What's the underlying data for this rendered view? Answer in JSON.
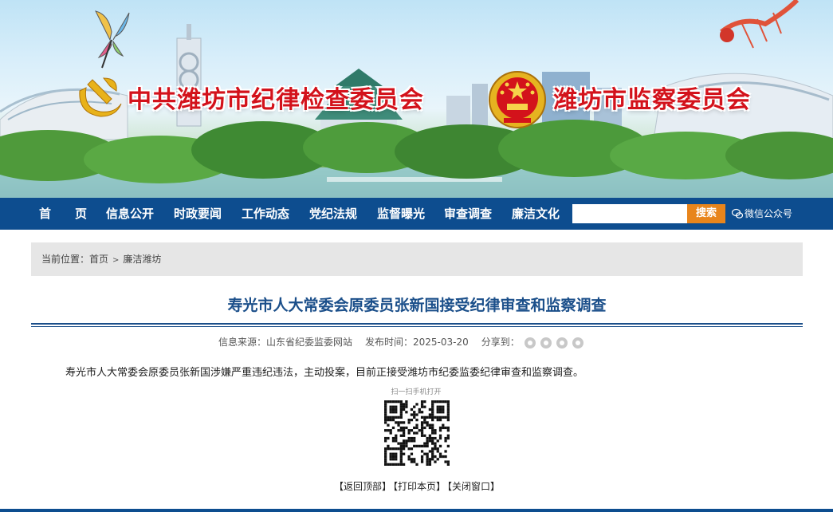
{
  "banner": {
    "title_left": "中共潍坊市纪律检查委员会",
    "title_right": "潍坊市监察委员会",
    "emblem_left": "party-emblem-icon",
    "emblem_right": "national-emblem-icon"
  },
  "nav": {
    "items": [
      "首　　页",
      "信息公开",
      "时政要闻",
      "工作动态",
      "党纪法规",
      "监督曝光",
      "审查调查",
      "廉洁文化"
    ],
    "search_value": "",
    "search_button": "搜索",
    "wechat_label": "微信公众号"
  },
  "breadcrumb": {
    "prefix": "当前位置：",
    "home": "首页",
    "separator": ">",
    "current": "廉洁潍坊"
  },
  "article": {
    "title": "寿光市人大常委会原委员张新国接受纪律审查和监察调查",
    "source": "信息来源：山东省纪委监委网站",
    "publish_time": "发布时间：2025-03-20",
    "share_label": "分享到：",
    "share_icons": [
      "wechat-icon",
      "weibo-icon",
      "qq-icon",
      "qzone-icon"
    ],
    "body": "寿光市人大常委会原委员张新国涉嫌严重违纪违法，主动投案，目前正接受潍坊市纪委监委纪律审查和监察调查。",
    "qr_caption": "扫一扫手机打开"
  },
  "footer": {
    "back_top": "【返回顶部】",
    "print": "【打印本页】",
    "close": "【关闭窗口】"
  },
  "colors": {
    "nav_bg": "#0d4d8f",
    "title_red": "#d3121b",
    "article_title": "#1b4f8a",
    "search_button": "#e8851c",
    "breadcrumb_bg": "#e6e6e6"
  }
}
